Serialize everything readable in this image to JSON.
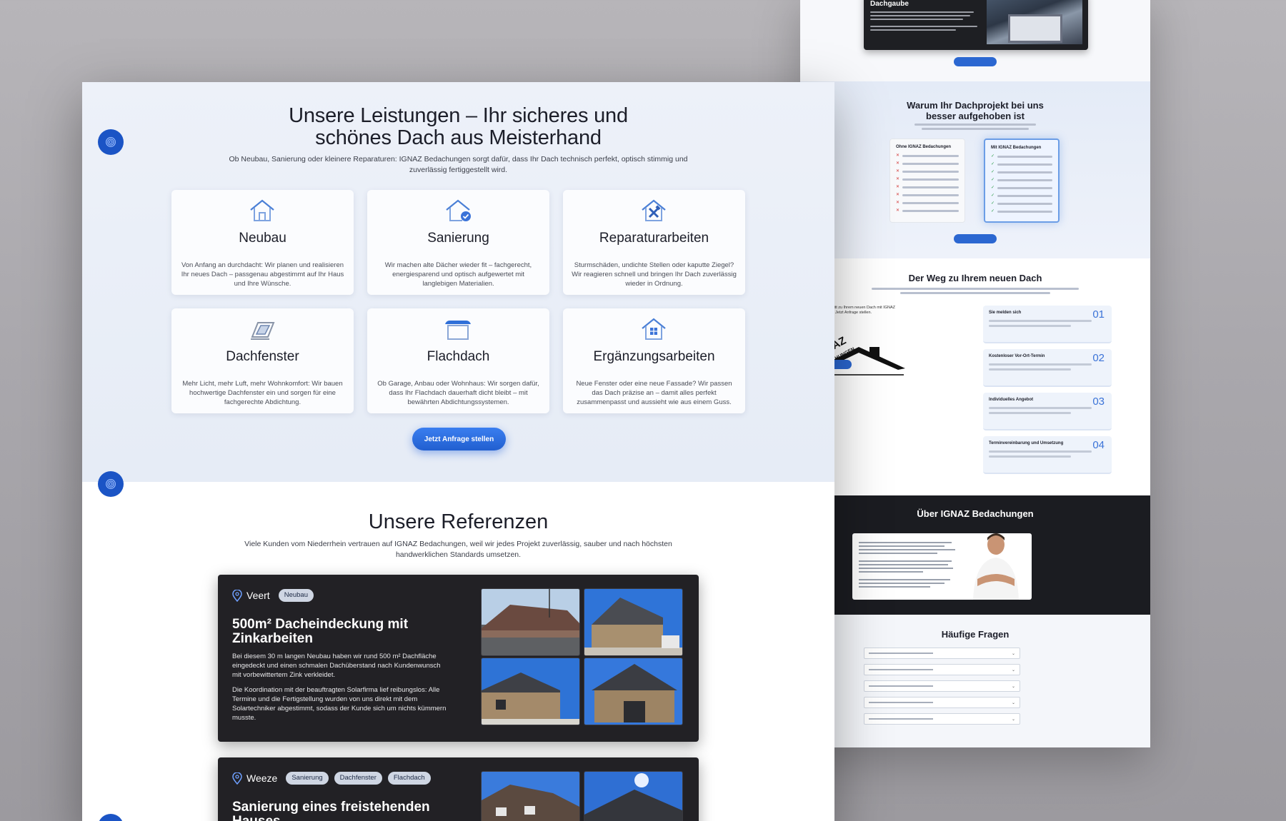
{
  "back_page": {
    "dachgaube_title": "Dachgaube",
    "why_title": "Warum Ihr Dachprojekt bei uns besser aufgehoben ist",
    "compare_without": "Ohne IGNAZ Bedachungen",
    "compare_with": "Mit IGNAZ Bedachungen",
    "weg_title": "Der Weg zu Ihrem neuen Dach",
    "weg_intro": "Der erste Schritt zu Ihrem neuen Dach mit IGNAZ Bedachungen: Jetzt Anfrage stellen.",
    "steps": [
      {
        "label": "Sie melden sich",
        "num": "01"
      },
      {
        "label": "Kostenloser Vor-Ort-Termin",
        "num": "02"
      },
      {
        "label": "Individuelles Angebot",
        "num": "03"
      },
      {
        "label": "Terminvereinbarung und Umsetzung",
        "num": "04"
      }
    ],
    "logo_text": "IGNAZ BEDACHUNGEN",
    "about_title": "Über IGNAZ Bedachungen",
    "faq_title": "Häufige Fragen",
    "faq_count": 5
  },
  "services": {
    "title": "Unsere Leistungen – Ihr sicheres und schönes Dach aus Meisterhand",
    "lead": "Ob Neubau, Sanierung oder kleinere Reparaturen: IGNAZ Bedachungen sorgt dafür, dass Ihr Dach technisch perfekt, optisch stimmig und zuverlässig fertiggestellt wird.",
    "cards": [
      {
        "icon": "house-icon",
        "title": "Neubau",
        "text": "Von Anfang an durchdacht: Wir planen und realisieren Ihr neues Dach – passgenau abgestimmt auf Ihr Haus und Ihre Wünsche."
      },
      {
        "icon": "house-check-icon",
        "title": "Sanierung",
        "text": "Wir machen alte Dächer wieder fit – fachgerecht, energiesparend und optisch aufgewertet mit langlebigen Materialien."
      },
      {
        "icon": "house-tools-icon",
        "title": "Reparaturarbeiten",
        "text": "Sturmschäden, undichte Stellen oder kaputte Ziegel? Wir reagieren schnell und bringen Ihr Dach zuverlässig wieder in Ordnung."
      },
      {
        "icon": "skylight-icon",
        "title": "Dachfenster",
        "text": "Mehr Licht, mehr Luft, mehr Wohnkomfort: Wir bauen hochwertige Dachfenster ein und sorgen für eine fachgerechte Abdichtung."
      },
      {
        "icon": "flat-roof-icon",
        "title": "Flachdach",
        "text": "Ob Garage, Anbau oder Wohnhaus: Wir sorgen dafür, dass Ihr Flachdach dauerhaft dicht bleibt – mit bewährten Abdichtungssystemen."
      },
      {
        "icon": "house-window-icon",
        "title": "Ergänzungsarbeiten",
        "text": "Neue Fenster oder eine neue Fassade? Wir passen das Dach präzise an – damit alles perfekt zusammenpasst und aussieht wie aus einem Guss."
      }
    ],
    "cta": "Jetzt Anfrage stellen"
  },
  "references": {
    "title": "Unsere Referenzen",
    "lead": "Viele Kunden vom Niederrhein vertrauen auf IGNAZ Bedachungen, weil wir jedes Projekt zuverlässig, sauber und nach höchsten handwerklichen Standards umsetzen.",
    "projects": [
      {
        "location": "Veert",
        "tags": [
          "Neubau"
        ],
        "title": "500m² Dacheindeckung mit Zinkarbeiten",
        "text1": "Bei diesem 30 m langen Neubau haben wir rund 500 m² Dachfläche eingedeckt und einen schmalen Dachüberstand nach Kundenwunsch mit vorbewittertem Zink verkleidet.",
        "text2": "Die Koordination mit der beauftragten Solarfirma lief reibungslos: Alle Termine und die Fertigstellung wurden von uns direkt mit dem Solartechniker abgestimmt, sodass der Kunde sich um nichts kümmern musste."
      },
      {
        "location": "Weeze",
        "tags": [
          "Sanierung",
          "Dachfenster",
          "Flachdach"
        ],
        "title": "Sanierung eines freistehenden Hauses"
      }
    ]
  },
  "colors": {
    "accent": "#2b67d1",
    "dark_card": "#222125",
    "section_bg": "#e9eef7"
  }
}
